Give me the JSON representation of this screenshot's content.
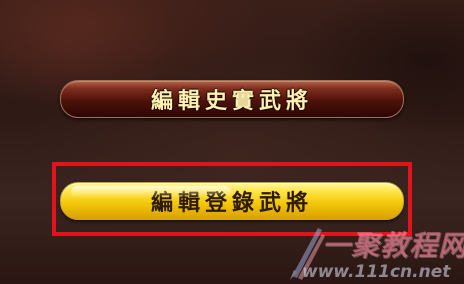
{
  "menu": {
    "historical_generals_button": "編輯史實武將",
    "registered_generals_button": "編輯登錄武將"
  },
  "watermark": {
    "site_name": "一聚教程网",
    "url": "www.111cn.net"
  },
  "colors": {
    "highlight_frame": "#e3131c",
    "historical_button_text": "#fff1b0",
    "registered_button_bg": "#f4c80a",
    "registered_button_text": "#2e1a02"
  }
}
